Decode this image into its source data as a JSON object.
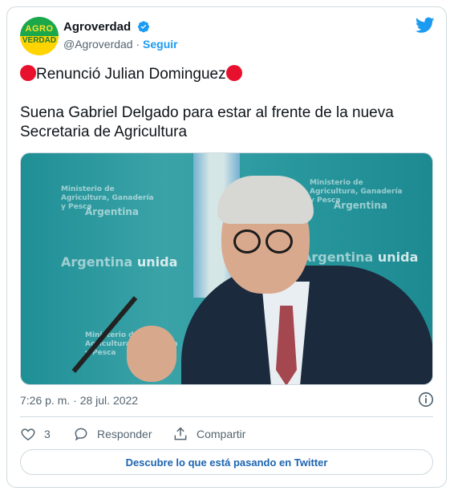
{
  "account": {
    "display_name": "Agroverdad",
    "handle": "@Agroverdad",
    "separator": "·",
    "follow_label": "Seguir",
    "avatar_text_top": "AGRO",
    "avatar_text_bottom": "VERDAD"
  },
  "tweet": {
    "line1": "Renunció Julian Dominguez",
    "line2": "Suena Gabriel Delgado para estar al frente de la nueva Secretaria de Agricultura",
    "timestamp": "7:26 p. m. · 28 jul. 2022"
  },
  "media": {
    "watermark_ministry": "Ministerio de Agricultura, Ganadería y Pesca",
    "watermark_country": "Argentina",
    "watermark_slogan_a": "Argentina",
    "watermark_slogan_b": "unida"
  },
  "actions": {
    "like_count": "3",
    "reply_label": "Responder",
    "share_label": "Compartir"
  },
  "cta": {
    "label": "Descubre lo que está pasando en Twitter"
  },
  "colors": {
    "brand_blue": "#1d9bf0",
    "red_dot": "#e8112d",
    "border": "#cfd9de",
    "muted": "#536471"
  },
  "icons": [
    "verified-badge-icon",
    "twitter-bird-icon",
    "info-icon",
    "heart-icon",
    "reply-bubble-icon",
    "share-icon"
  ]
}
